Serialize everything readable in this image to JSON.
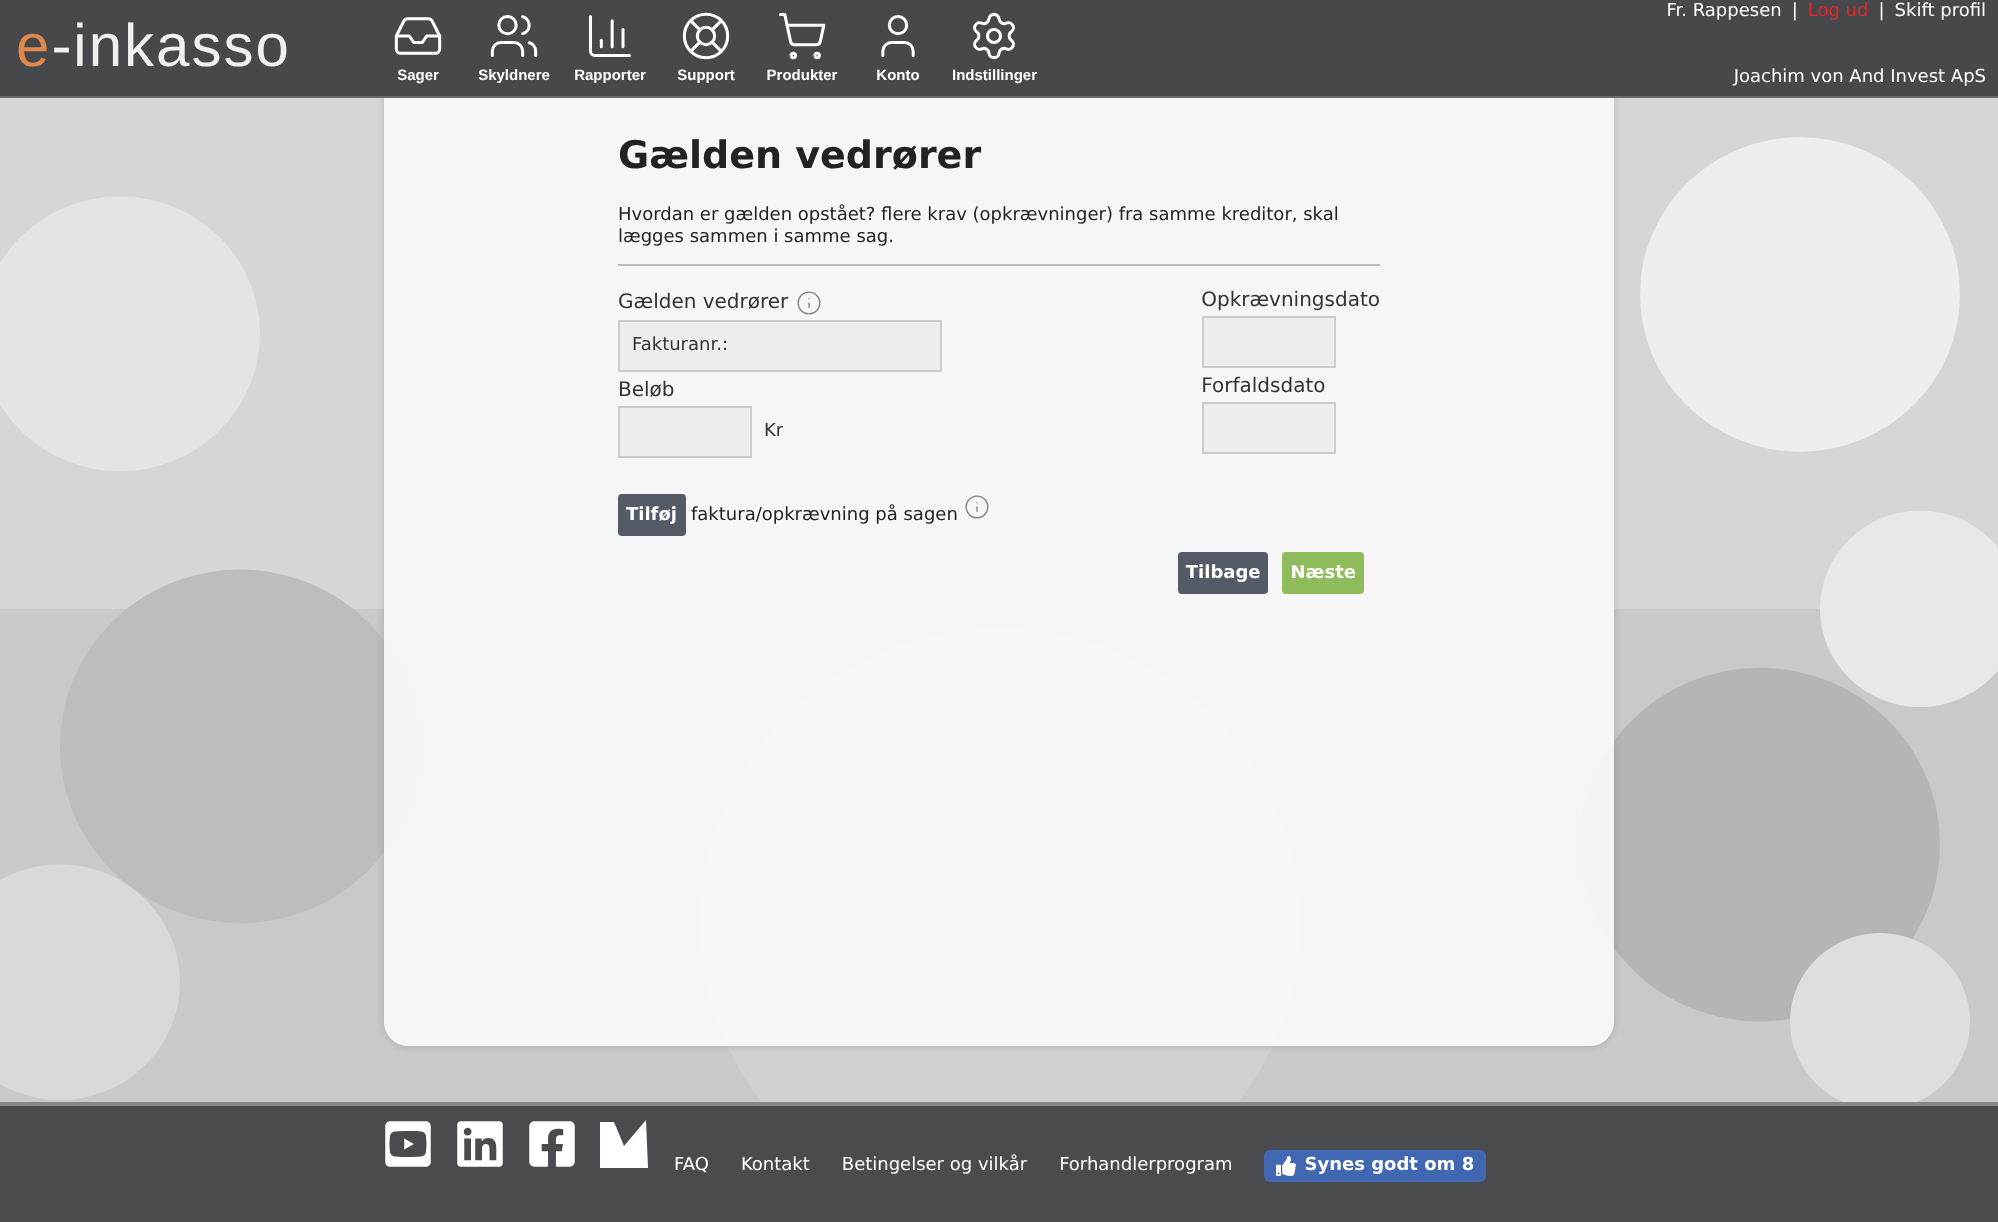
{
  "header": {
    "logo": {
      "accent": "e",
      "rest": "-inkasso"
    },
    "nav": [
      {
        "label": "Sager"
      },
      {
        "label": "Skyldnere"
      },
      {
        "label": "Rapporter"
      },
      {
        "label": "Support"
      },
      {
        "label": "Produkter"
      },
      {
        "label": "Konto"
      },
      {
        "label": "Indstillinger"
      }
    ],
    "user_links": [
      {
        "label": "Fr. Rappesen",
        "kind": "plain"
      },
      {
        "label": "Log ud",
        "kind": "logout"
      },
      {
        "label": "Skift profil",
        "kind": "plain"
      }
    ],
    "separators": [
      "|",
      "|"
    ],
    "company": "Joachim von And Invest ApS"
  },
  "form": {
    "title": "Gælden vedrører",
    "intro": "Hvordan er gælden opstået? flere krav (opkrævninger) fra samme kreditor, skal lægges sammen i samme sag.",
    "subject": {
      "label": "Gælden vedrører",
      "placeholder": "Fakturanr.:"
    },
    "amount": {
      "label": "Beløb",
      "unit": "Kr"
    },
    "dates": [
      {
        "label": "Opkrævningsdato"
      },
      {
        "label": "Forfaldsdato"
      }
    ],
    "add_button": "Tilføj",
    "add_text": "faktura/opkrævning på sagen",
    "buttons": [
      {
        "label": "Tilbage",
        "kind": "back"
      },
      {
        "label": "Næste",
        "kind": "next"
      }
    ]
  },
  "footer": {
    "social": [
      {
        "kind": "youtube"
      },
      {
        "kind": "linkedin"
      },
      {
        "kind": "facebook"
      },
      {
        "kind": "brand"
      }
    ],
    "links": [
      "FAQ",
      "Kontakt",
      "Betingelser og vilkår",
      "Forhandlerprogram"
    ],
    "like_button": "Synes godt om 8"
  }
}
